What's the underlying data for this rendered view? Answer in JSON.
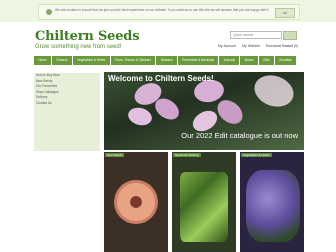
{
  "cookie": {
    "text": "We use cookies to ensure that we give you the best experience on our website. If you continue to use this site we will assume that you are happy with it.",
    "button": "OK"
  },
  "header": {
    "logo": "Chiltern Seeds",
    "tagline": "Grow something new from seed!",
    "search_placeholder": "Quick search",
    "top_links": [
      "My Account",
      "My Wishlist",
      "Download Basket (0)"
    ]
  },
  "nav": {
    "items": [
      "Home",
      "Flowers",
      "Vegetables & Herbs",
      "Trees, Shrubs & Climbers",
      "Grasses",
      "Perennials & Biennials",
      "Annuals",
      "Books",
      "Gifts",
      "Sundries"
    ]
  },
  "sidebar": {
    "items": [
      "How to Buy Now",
      "New Seeds",
      "Our Favourites",
      "Shop Catalogue",
      "Delivery",
      "Contact Us"
    ]
  },
  "hero": {
    "title": "Welcome to Chiltern Seeds!",
    "subtitle": "Our 2022 Edit catalogue is out now"
  },
  "tiles": [
    {
      "label": "New Seeds"
    },
    {
      "label": "Seeds for Sowing"
    },
    {
      "label": "Vegetables & Herbs"
    }
  ],
  "colors": {
    "brand_green": "#3e7d23",
    "nav_green": "#6a9a3c",
    "sidebar_bg": "#e6efd7"
  }
}
